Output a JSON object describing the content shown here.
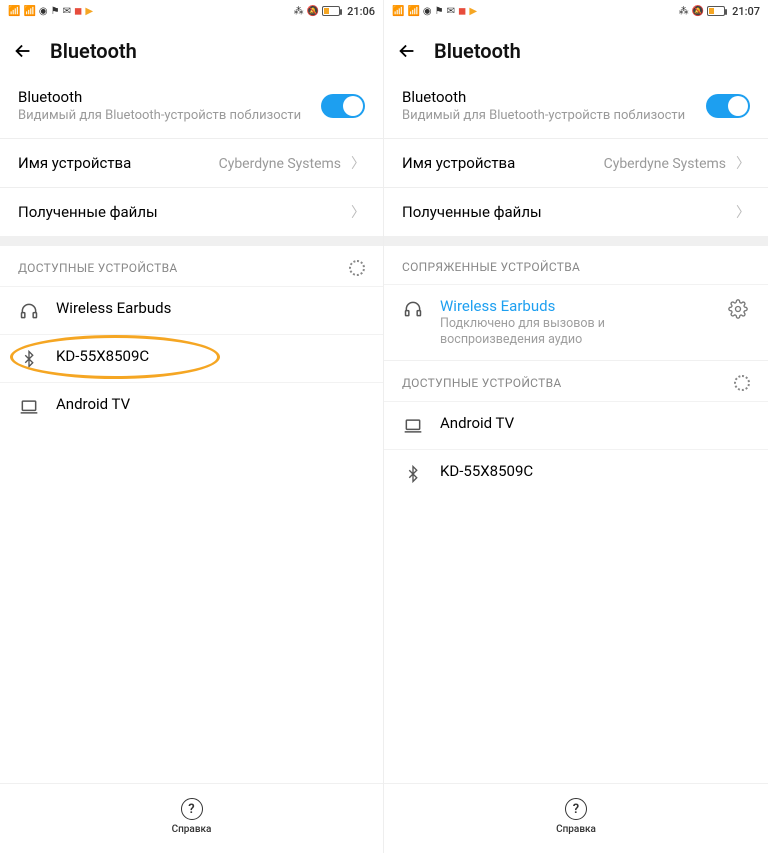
{
  "left": {
    "status": {
      "time": "21:06"
    },
    "appbar": {
      "title": "Bluetooth"
    },
    "bt": {
      "title": "Bluetooth",
      "subtitle": "Видимый для Bluetooth-устройств поблизости"
    },
    "device_name_row": {
      "label": "Имя устройства",
      "value": "Cyberdyne Systems"
    },
    "received_row": {
      "label": "Полученные файлы"
    },
    "available_header": "ДОСТУПНЫЕ УСТРОЙСТВА",
    "devices": [
      {
        "icon": "headphones",
        "name": "Wireless Earbuds"
      },
      {
        "icon": "bluetooth",
        "name": "KD-55X8509C"
      },
      {
        "icon": "laptop",
        "name": "Android TV"
      }
    ],
    "help": "Справка"
  },
  "right": {
    "status": {
      "time": "21:07"
    },
    "appbar": {
      "title": "Bluetooth"
    },
    "bt": {
      "title": "Bluetooth",
      "subtitle": "Видимый для Bluetooth-устройств поблизости"
    },
    "device_name_row": {
      "label": "Имя устройства",
      "value": "Cyberdyne Systems"
    },
    "received_row": {
      "label": "Полученные файлы"
    },
    "paired_header": "СОПРЯЖЕННЫЕ УСТРОЙСТВА",
    "paired": {
      "icon": "headphones",
      "name": "Wireless Earbuds",
      "sub": "Подключено для вызовов и воспроизведения аудио"
    },
    "available_header": "ДОСТУПНЫЕ УСТРОЙСТВА",
    "devices": [
      {
        "icon": "laptop",
        "name": "Android TV"
      },
      {
        "icon": "bluetooth",
        "name": "KD-55X8509C"
      }
    ],
    "help": "Справка"
  }
}
